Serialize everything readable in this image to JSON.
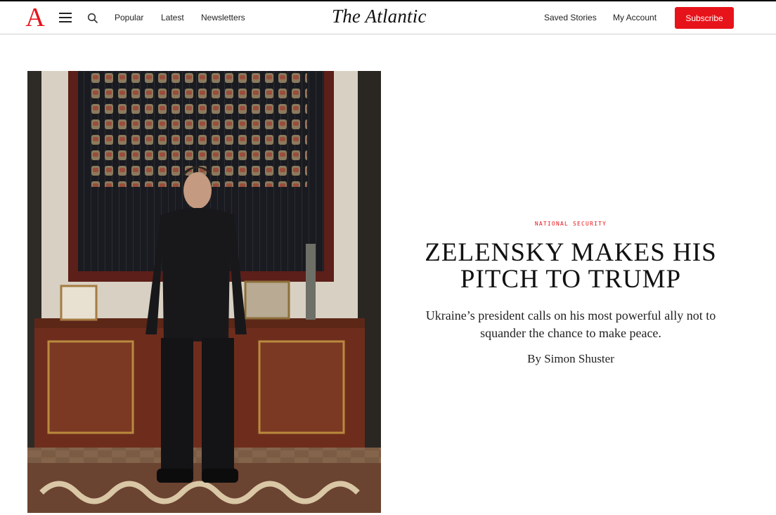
{
  "header": {
    "logo_letter": "A",
    "brand": "The Atlantic",
    "nav": [
      "Popular",
      "Latest",
      "Newsletters"
    ],
    "saved": "Saved Stories",
    "account": "My Account",
    "subscribe": "Subscribe"
  },
  "article": {
    "kicker": "NATIONAL SECURITY",
    "headline_line1": "ZELENSKY MAKES HIS",
    "headline_line2": "PITCH TO TRUMP",
    "dek": "Ukraine’s president calls on his most powerful ally not to squander the chance to make peace.",
    "byline": "By Simon Shuster"
  },
  "colors": {
    "accent": "#e7131a",
    "text": "#111111"
  },
  "icons": [
    "menu-icon",
    "search-icon"
  ]
}
